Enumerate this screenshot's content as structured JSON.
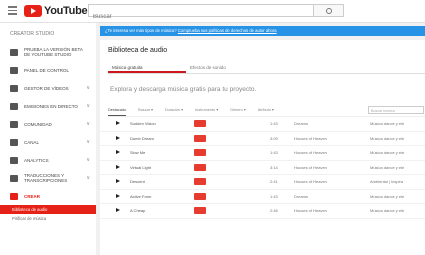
{
  "topbar": {
    "logo_text": "YouTube",
    "logo_sup": "ES",
    "search_placeholder": "Buscar"
  },
  "sidebar": {
    "title": "CREATOR STUDIO",
    "items": [
      {
        "label": "PRUEBA LA VERSIÓN BETA DE YOUTUBE STUDIO",
        "chevron": ""
      },
      {
        "label": "PANEL DE CONTROL",
        "chevron": ""
      },
      {
        "label": "GESTOR DE VÍDEOS",
        "chevron": "∨"
      },
      {
        "label": "EMISIONES EN DIRECTO",
        "chevron": "∨"
      },
      {
        "label": "COMUNIDAD",
        "chevron": "∨"
      },
      {
        "label": "CANAL",
        "chevron": "∨"
      },
      {
        "label": "ANALYTICS",
        "chevron": "∨"
      },
      {
        "label": "TRADUCCIONES Y TRANSCRIPCIONES",
        "chevron": "∨"
      },
      {
        "label": "CREAR",
        "chevron": ""
      }
    ],
    "sub_active": "Biblioteca de audio",
    "sub_other": "Pirificar de música"
  },
  "banner": {
    "text": "¿Te interesa ver más tipos de música? ",
    "link": "Comprueba sus políticas de derechos de autor ahora"
  },
  "main": {
    "title": "Biblioteca de audio",
    "tabs": [
      "Música gratuita",
      "Efectos de sonido"
    ],
    "subtitle": "Explora y descarga música gratis para tu proyecto.",
    "filters": [
      "Destacado",
      "Buscar ▾",
      "Duración ▾",
      "Instrumento ▾",
      "Género ▾",
      "Atributo ▾"
    ],
    "search_placeholder": "Buscar música",
    "rows": [
      {
        "title": "Sudden Vision",
        "duration": "1:43",
        "genre": "Dreams",
        "mood": "Música dance y ele"
      },
      {
        "title": "Dumb Dream",
        "duration": "3:09",
        "genre": "Houses of Heaven",
        "mood": "Música dance y ele"
      },
      {
        "title": "Slow Me",
        "duration": "1:43",
        "genre": "Houses of Heaven",
        "mood": "Música dance y ele"
      },
      {
        "title": "Virtual Light",
        "duration": "3:14",
        "genre": "Houses of Heaven",
        "mood": "Música dance y ele"
      },
      {
        "title": "Descent",
        "duration": "2:41",
        "genre": "Houses of Heaven",
        "mood": "Ambiental | Inspira"
      },
      {
        "title": "Active Form",
        "duration": "1:43",
        "genre": "Dreams",
        "mood": "Música dance y ele"
      },
      {
        "title": "A Cheap",
        "duration": "2:46",
        "genre": "Houses of Heaven",
        "mood": "Música dance y ele"
      }
    ]
  }
}
